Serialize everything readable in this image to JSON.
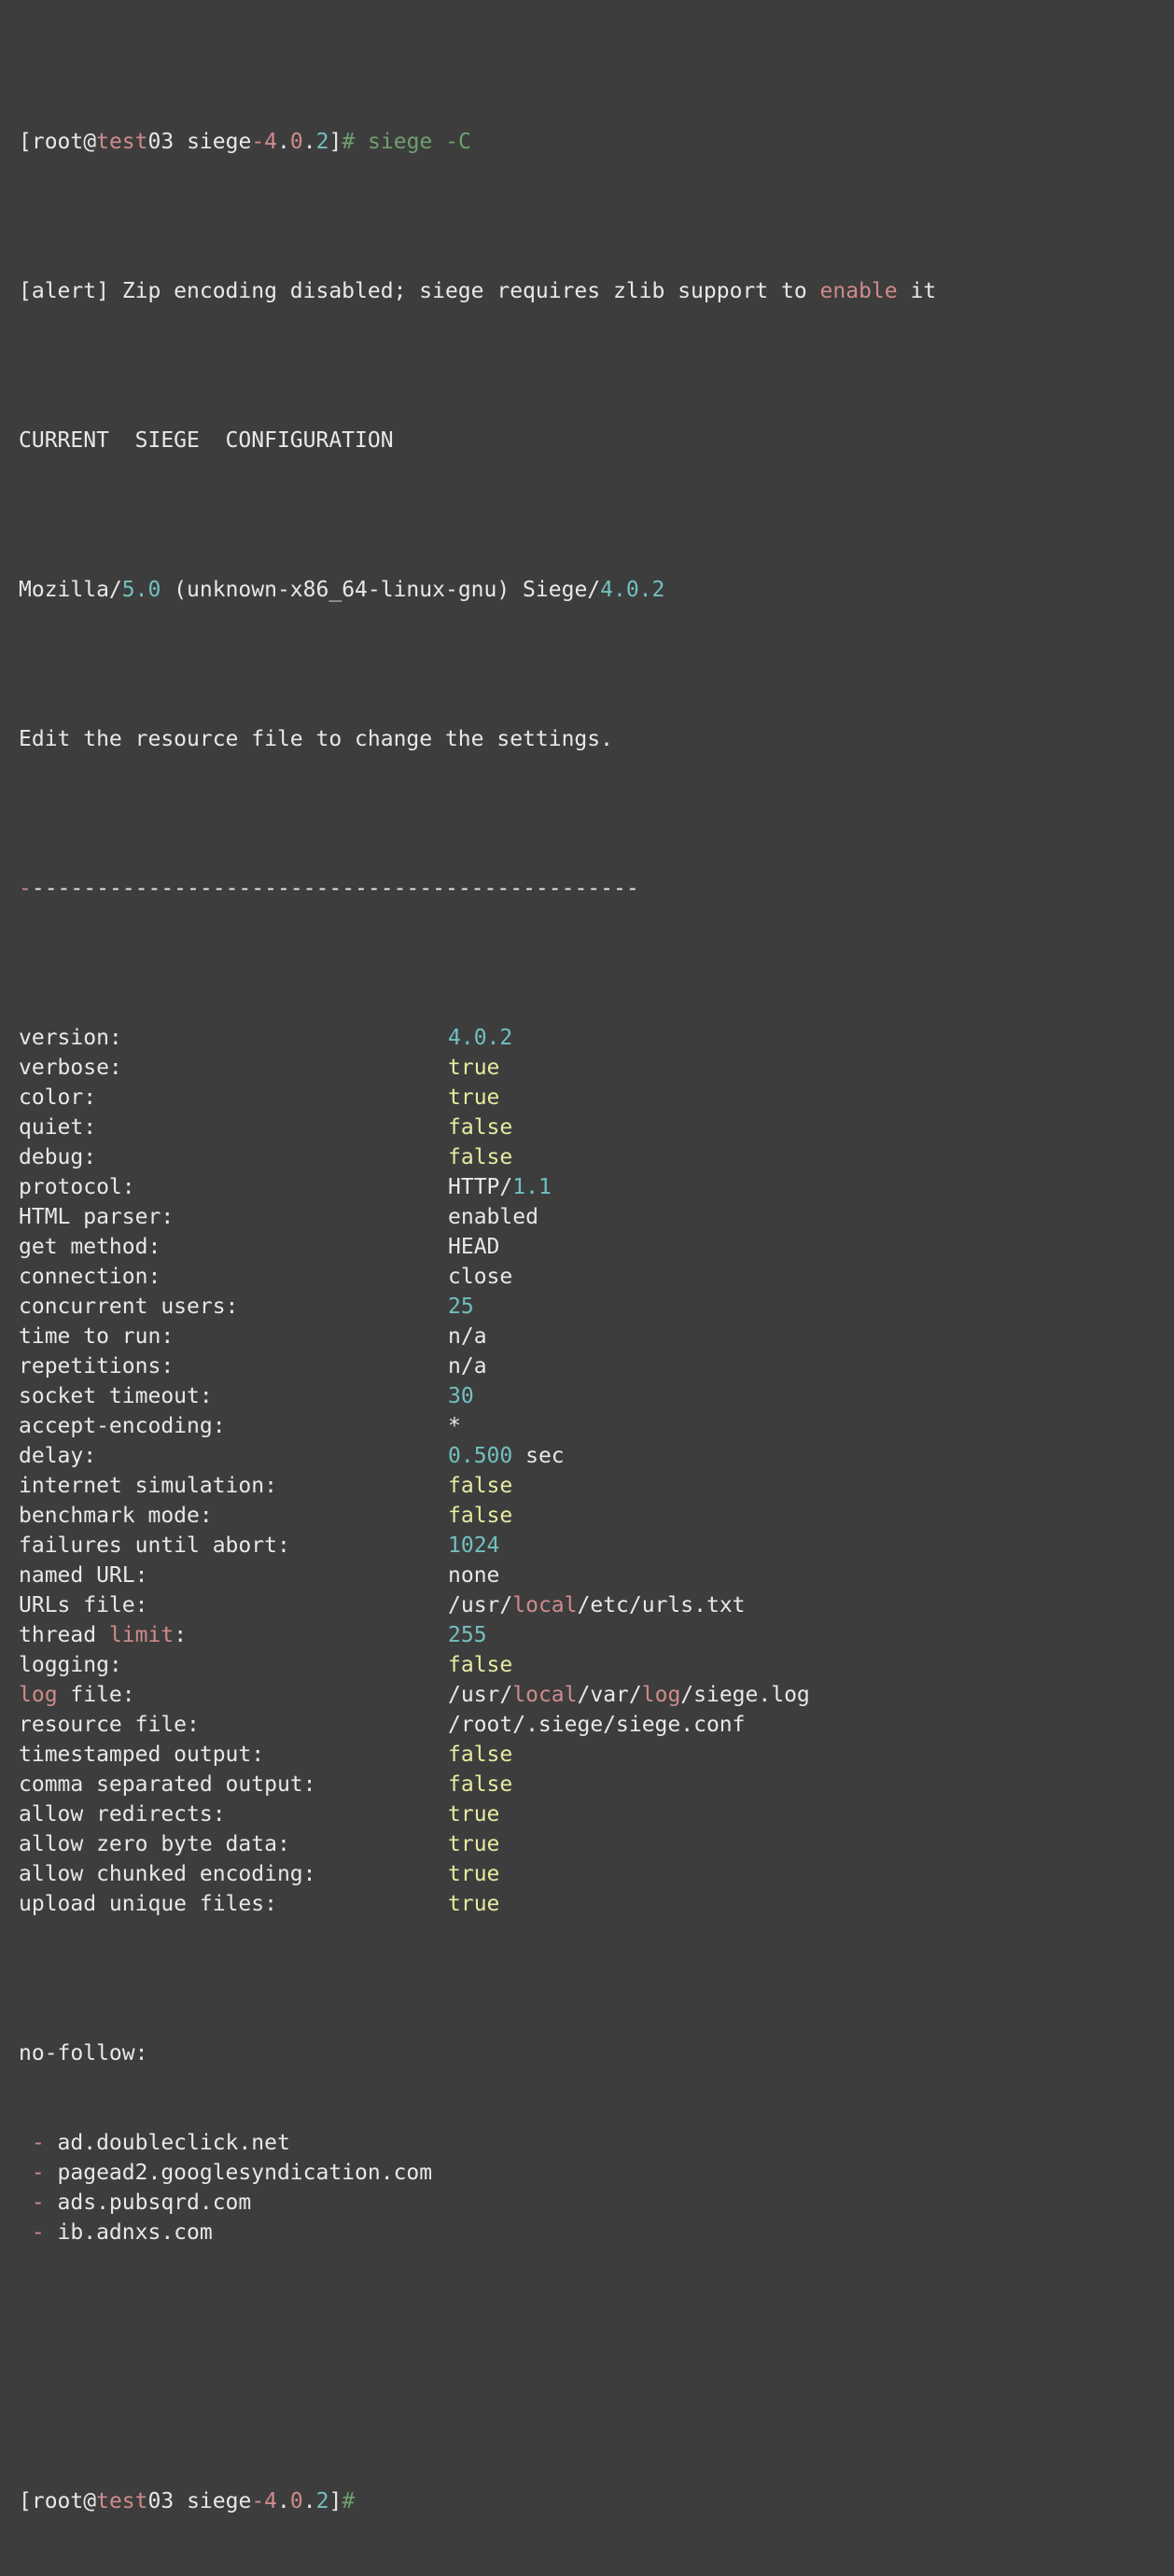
{
  "terminal": {
    "background_color": "#3d3d3d",
    "foreground_color": "#e8e8e8",
    "colors": {
      "white": "#e8e8e8",
      "pink": "#d08a8a",
      "teal": "#72c0c0",
      "green": "#6f9f6f",
      "yellow": "#e6eba0"
    }
  },
  "prompt_top": {
    "bracket_open": "[",
    "user": "root",
    "at": "@",
    "host_highlight": "test",
    "host_rest": "03",
    "space": " ",
    "dir_prefix": "siege",
    "dir_dash": "-",
    "dir_major": "4",
    "dir_dot1": ".",
    "dir_minor": "0",
    "dir_dot2": ".",
    "dir_patch": "2",
    "bracket_close": "]",
    "hash": "#",
    "command": " siege -C"
  },
  "alert_line": {
    "prefix": "[alert] Zip encoding disabled; siege requires zlib support to ",
    "keyword": "enable",
    "suffix": " it"
  },
  "heading": "CURRENT  SIEGE  CONFIGURATION",
  "useragent": {
    "part1": "Mozilla/",
    "version1": "5.0",
    "part2": " (unknown-x86_64-linux-gnu) Siege/",
    "version2": "4.0.2"
  },
  "edit_note": "Edit the resource file to change the settings.",
  "separator": {
    "first_dash": "-",
    "rest": "-----------------------------------------------"
  },
  "config": [
    {
      "label": "version:",
      "value": "4.0.2",
      "value_color": "teal"
    },
    {
      "label": "verbose:",
      "value": "true",
      "value_color": "yellow"
    },
    {
      "label": "color:",
      "value": "true",
      "value_color": "yellow"
    },
    {
      "label": "quiet:",
      "value": "false",
      "value_color": "yellow"
    },
    {
      "label": "debug:",
      "value": "false",
      "value_color": "yellow"
    },
    {
      "label": "protocol:",
      "value_parts": [
        {
          "text": "HTTP/",
          "color": "white"
        },
        {
          "text": "1.1",
          "color": "teal"
        }
      ]
    },
    {
      "label": "HTML parser:",
      "value": "enabled",
      "value_color": "white"
    },
    {
      "label": "get method:",
      "value": "HEAD",
      "value_color": "white"
    },
    {
      "label": "connection:",
      "value": "close",
      "value_color": "white"
    },
    {
      "label": "concurrent users:",
      "value": "25",
      "value_color": "teal"
    },
    {
      "label": "time to run:",
      "value": "n/a",
      "value_color": "white"
    },
    {
      "label": "repetitions:",
      "value": "n/a",
      "value_color": "white"
    },
    {
      "label": "socket timeout:",
      "value": "30",
      "value_color": "teal"
    },
    {
      "label": "accept-encoding:",
      "value": "*",
      "value_color": "white"
    },
    {
      "label": "delay:",
      "value_parts": [
        {
          "text": "0.500",
          "color": "teal"
        },
        {
          "text": " sec",
          "color": "white"
        }
      ]
    },
    {
      "label": "internet simulation:",
      "value": "false",
      "value_color": "yellow"
    },
    {
      "label": "benchmark mode:",
      "value": "false",
      "value_color": "yellow"
    },
    {
      "label": "failures until abort:",
      "value": "1024",
      "value_color": "teal"
    },
    {
      "label": "named URL:",
      "value": "none",
      "value_color": "white"
    },
    {
      "label": "URLs file:",
      "value_parts": [
        {
          "text": "/usr/",
          "color": "white"
        },
        {
          "text": "local",
          "color": "pink"
        },
        {
          "text": "/etc/urls.txt",
          "color": "white"
        }
      ]
    },
    {
      "label_parts": [
        {
          "text": "thread ",
          "color": "white"
        },
        {
          "text": "limit",
          "color": "pink"
        },
        {
          "text": ":",
          "color": "white"
        }
      ],
      "value": "255",
      "value_color": "teal"
    },
    {
      "label": "logging:",
      "value": "false",
      "value_color": "yellow"
    },
    {
      "label_parts": [
        {
          "text": "log",
          "color": "pink"
        },
        {
          "text": " file:",
          "color": "white"
        }
      ],
      "value_parts": [
        {
          "text": "/usr/",
          "color": "white"
        },
        {
          "text": "local",
          "color": "pink"
        },
        {
          "text": "/var/",
          "color": "white"
        },
        {
          "text": "log",
          "color": "pink"
        },
        {
          "text": "/siege.log",
          "color": "white"
        }
      ]
    },
    {
      "label": "resource file:",
      "value": "/root/.siege/siege.conf",
      "value_color": "white"
    },
    {
      "label": "timestamped output:",
      "value": "false",
      "value_color": "yellow"
    },
    {
      "label": "comma separated output:",
      "value": "false",
      "value_color": "yellow"
    },
    {
      "label": "allow redirects:",
      "value": "true",
      "value_color": "yellow"
    },
    {
      "label": "allow zero byte data:",
      "value": "true",
      "value_color": "yellow"
    },
    {
      "label": "allow chunked encoding:",
      "value": "true",
      "value_color": "yellow"
    },
    {
      "label": "upload unique files:",
      "value": "true",
      "value_color": "yellow"
    }
  ],
  "nofollow": {
    "label": "no-follow:",
    "bullet": "-",
    "entries": [
      "ad.doubleclick.net",
      "pagead2.googlesyndication.com",
      "ads.pubsqrd.com",
      "ib.adnxs.com"
    ]
  },
  "prompt_bottom": {
    "bracket_open": "[",
    "user": "root",
    "at": "@",
    "host_highlight": "test",
    "host_rest": "03",
    "space": " ",
    "dir_prefix": "siege",
    "dir_dash": "-",
    "dir_major": "4",
    "dir_dot1": ".",
    "dir_minor": "0",
    "dir_dot2": ".",
    "dir_patch": "2",
    "bracket_close": "]",
    "hash": "#"
  }
}
